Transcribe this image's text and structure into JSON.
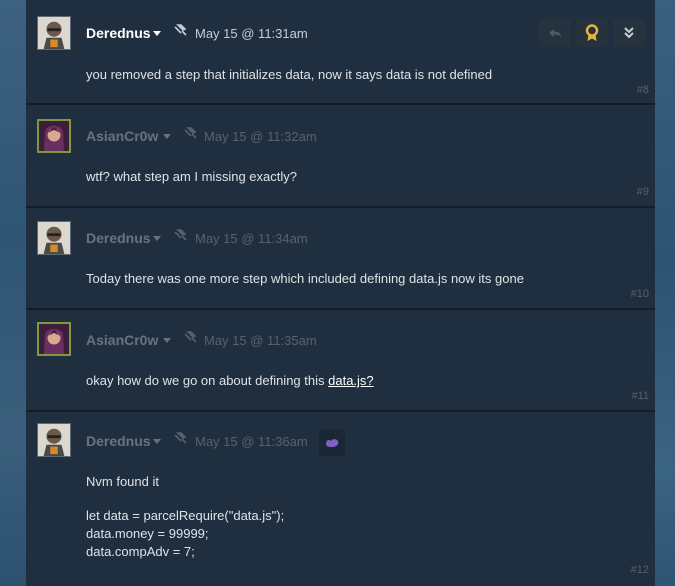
{
  "comments": [
    {
      "author": "Derednus",
      "date": "May 15 @ 11:31am",
      "text": "you removed a step that initializes data, now it says data is not defined",
      "number": "#8"
    },
    {
      "author": "AsianCr0w",
      "date": "May 15 @ 11:32am",
      "text": "wtf? what step am I missing exactly?",
      "number": "#9"
    },
    {
      "author": "Derednus",
      "date": "May 15 @ 11:34am",
      "text": "Today there was one more step which included defining data.js now its gone",
      "number": "#10"
    },
    {
      "author": "AsianCr0w",
      "date": "May 15 @ 11:35am",
      "text_before": "okay how do we go on about defining this ",
      "link_text": "data.js?",
      "number": "#11"
    },
    {
      "author": "Derednus",
      "date": "May 15 @ 11:36am",
      "lines": [
        "Nvm found it",
        "",
        "let data = parcelRequire(\"data.js\");",
        "data.money = 99999;",
        "data.compAdv = 7;"
      ],
      "number": "#12"
    }
  ],
  "icons": {
    "reply": "reply-icon",
    "award": "award-icon",
    "more": "chevron-double-down-icon",
    "pin": "pin-icon",
    "emoticon": "emoticon-icon"
  },
  "colors": {
    "award": "#e2b53c",
    "emoticon": "#7f5fc4"
  }
}
